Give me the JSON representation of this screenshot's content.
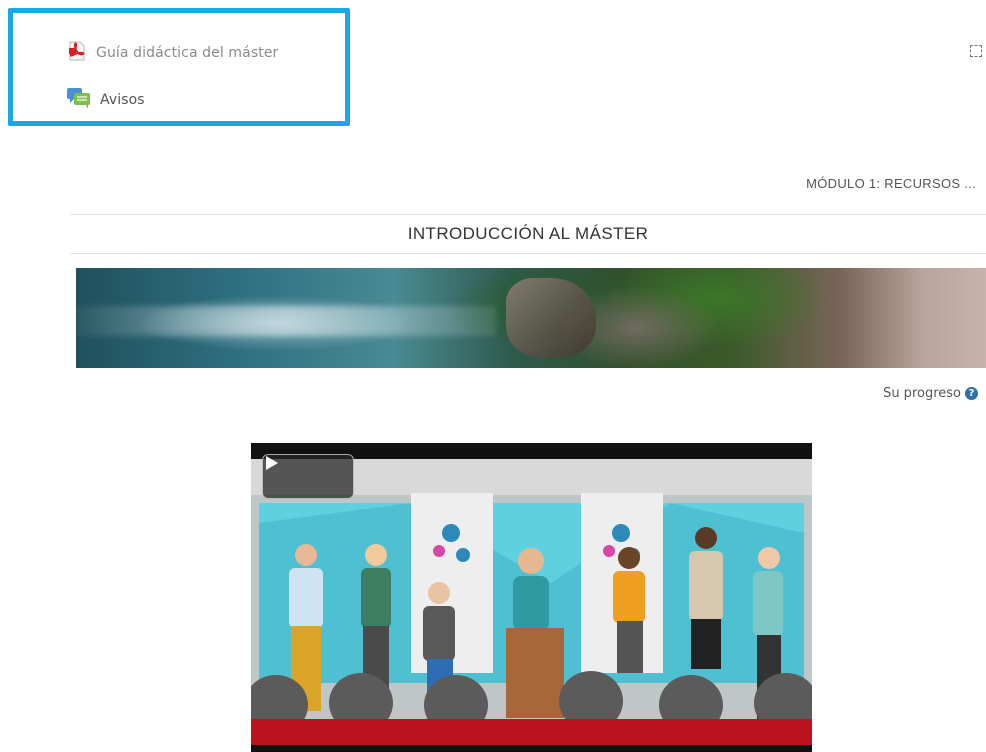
{
  "activities": [
    {
      "label": "Guía didáctica del máster",
      "icon": "pdf-icon"
    },
    {
      "label": "Avisos",
      "icon": "forum-icon"
    }
  ],
  "module_link": "MÓDULO 1: RECURSOS ...",
  "section_title": "INTRODUCCIÓN AL MÁSTER",
  "progress": {
    "label": "Su progreso",
    "icon": "help-icon",
    "help_glyph": "?"
  },
  "video": {
    "play_icon": "play-icon"
  },
  "colors": {
    "highlight": "#1aa6e8",
    "help": "#2f6fae"
  }
}
